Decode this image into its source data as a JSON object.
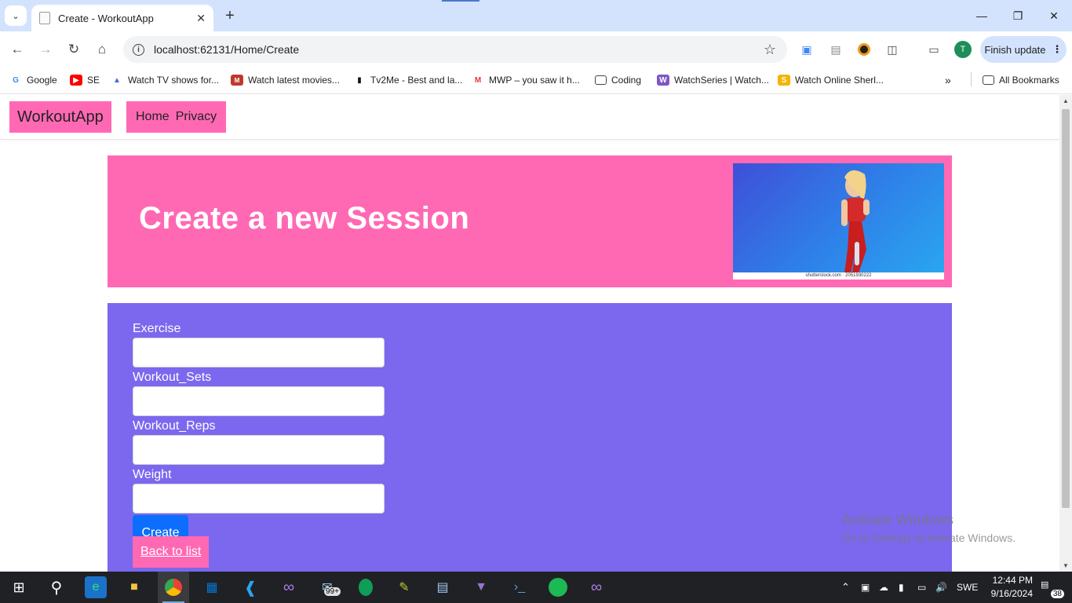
{
  "browser": {
    "tab_title": "Create - WorkoutApp",
    "url": "localhost:62131/Home/Create",
    "finish_update_label": "Finish update",
    "profile_initial": "T",
    "bookmarks": [
      {
        "label": "Google",
        "icon": "google-icon",
        "color": "#4285f4"
      },
      {
        "label": "SE",
        "icon": "youtube-icon",
        "color": "#ff0000"
      },
      {
        "label": "Watch TV shows for...",
        "icon": "tv-icon",
        "color": "#3a6fd8"
      },
      {
        "label": "Watch latest movies...",
        "icon": "movie-icon",
        "color": "#c0392b"
      },
      {
        "label": "Tv2Me - Best and la...",
        "icon": "tv2me-icon",
        "color": "#111111"
      },
      {
        "label": "MWP – you saw it h...",
        "icon": "mwp-icon",
        "color": "#e53935"
      },
      {
        "label": "Coding",
        "icon": "folder-icon",
        "color": "#444444"
      },
      {
        "label": "WatchSeries | Watch...",
        "icon": "watchseries-icon",
        "color": "#7f57c2"
      },
      {
        "label": "Watch Online Sherl...",
        "icon": "sherlock-icon",
        "color": "#f4b400"
      }
    ],
    "all_bookmarks_label": "All Bookmarks"
  },
  "site": {
    "brand": "WorkoutApp",
    "nav": [
      "Home",
      "Privacy"
    ]
  },
  "hero": {
    "title": "Create a new Session",
    "image_caption": "shutterstock.com · 2051930222"
  },
  "form": {
    "fields": [
      {
        "label": "Exercise",
        "value": ""
      },
      {
        "label": "Workout_Sets",
        "value": ""
      },
      {
        "label": "Workout_Reps",
        "value": ""
      },
      {
        "label": "Weight",
        "value": ""
      }
    ],
    "submit_label": "Create",
    "back_label": "Back to list"
  },
  "watermark": {
    "line1": "Activate Windows",
    "line2": "Go to Settings to activate Windows."
  },
  "taskbar": {
    "mail_badge": "99+",
    "language": "SWE",
    "time": "12:44 PM",
    "date": "9/16/2024",
    "notification_count": "38"
  },
  "colors": {
    "brand_pink": "#ff69b4",
    "form_purple": "#7b68ee",
    "primary_blue": "#0d6efd"
  }
}
